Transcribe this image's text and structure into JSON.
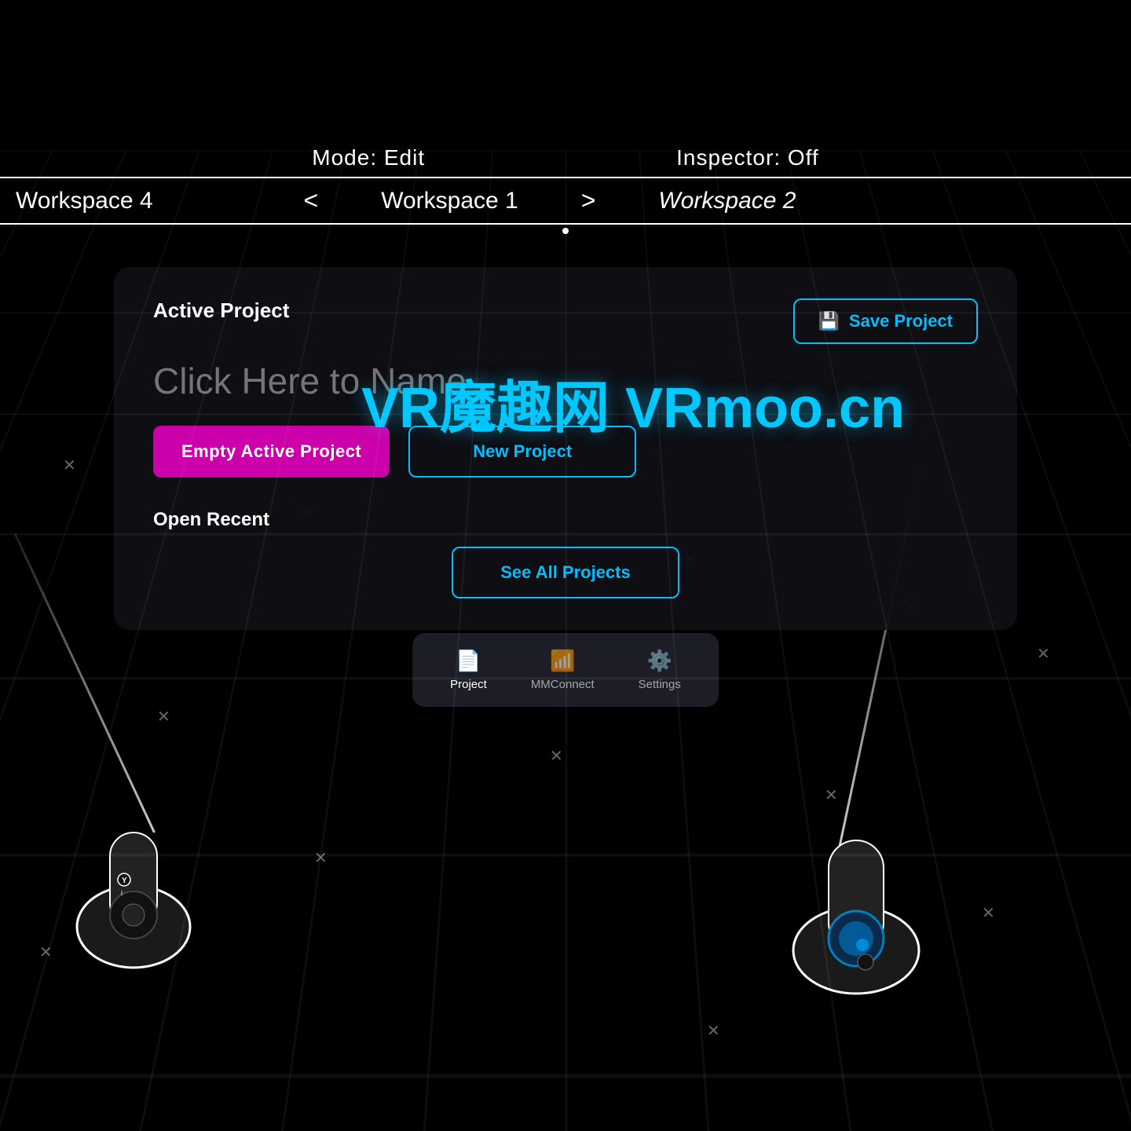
{
  "background": "#000000",
  "topBar": {
    "modeLabel": "Mode: Edit",
    "inspectorLabel": "Inspector: Off"
  },
  "workspaceBar": {
    "leftOverflow": "Workspace 4",
    "prevArrow": "<",
    "current": "Workspace 1",
    "nextArrow": ">",
    "right": "Workspace 2"
  },
  "panel": {
    "activProjectLabel": "Active Project",
    "projectNamePlaceholder": "Click Here to Name",
    "saveProjectLabel": "Save Project",
    "saveIcon": "💾",
    "emptyActiveLabel": "Empty Active Project",
    "newProjectLabel": "New Project",
    "openRecentLabel": "Open Recent",
    "seeAllLabel": "See All Projects"
  },
  "tabBar": {
    "tabs": [
      {
        "id": "project",
        "icon": "📄",
        "label": "Project",
        "active": true
      },
      {
        "id": "mmconnect",
        "icon": "📶",
        "label": "MMConnect",
        "active": false
      },
      {
        "id": "settings",
        "icon": "⚙️",
        "label": "Settings",
        "active": false
      }
    ]
  },
  "watermark": "VR魔趣网  VRmoo.cn",
  "colors": {
    "accent": "#00bfff",
    "magenta": "#cc00aa",
    "panelBg": "rgba(15,15,20,0.95)",
    "tabBg": "rgba(30,30,40,0.97)"
  }
}
